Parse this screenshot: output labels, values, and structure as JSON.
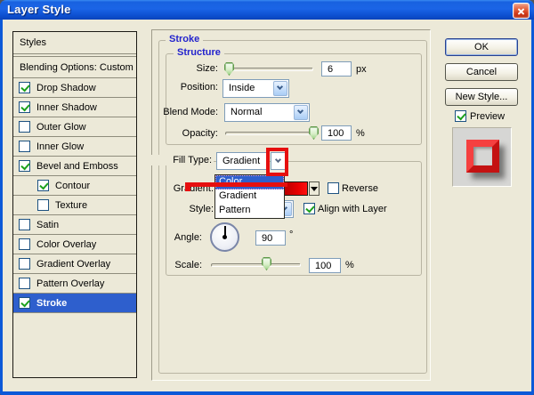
{
  "window": {
    "title": "Layer Style"
  },
  "styles_panel": {
    "header": "Styles",
    "blending": "Blending Options: Custom",
    "items": [
      {
        "label": "Drop Shadow",
        "checked": true
      },
      {
        "label": "Inner Shadow",
        "checked": true
      },
      {
        "label": "Outer Glow",
        "checked": false
      },
      {
        "label": "Inner Glow",
        "checked": false
      },
      {
        "label": "Bevel and Emboss",
        "checked": true
      },
      {
        "label": "Contour",
        "checked": true,
        "indent": true
      },
      {
        "label": "Texture",
        "checked": false,
        "indent": true
      },
      {
        "label": "Satin",
        "checked": false
      },
      {
        "label": "Color Overlay",
        "checked": false
      },
      {
        "label": "Gradient Overlay",
        "checked": false
      },
      {
        "label": "Pattern Overlay",
        "checked": false
      },
      {
        "label": "Stroke",
        "checked": true,
        "selected": true
      }
    ]
  },
  "stroke_panel": {
    "group_label": "Stroke",
    "structure_label": "Structure",
    "size": {
      "label": "Size:",
      "value": "6",
      "unit": "px"
    },
    "position": {
      "label": "Position:",
      "value": "Inside"
    },
    "blend_mode": {
      "label": "Blend Mode:",
      "value": "Normal"
    },
    "opacity": {
      "label": "Opacity:",
      "value": "100",
      "unit": "%"
    },
    "fill_type": {
      "label": "Fill Type:",
      "value": "Gradient"
    },
    "fill_type_options": [
      "Color",
      "Gradient",
      "Pattern"
    ],
    "fill_type_highlighted_option": "Color",
    "gradient": {
      "label": "Gradient:",
      "reverse_label": "Reverse",
      "reverse_checked": false
    },
    "style": {
      "label": "Style:",
      "align_label": "Align with Layer",
      "align_checked": true
    },
    "angle": {
      "label": "Angle:",
      "value": "90",
      "unit": "°"
    },
    "scale": {
      "label": "Scale:",
      "value": "100",
      "unit": "%"
    }
  },
  "buttons": {
    "ok": "OK",
    "cancel": "Cancel",
    "new_style": "New Style...",
    "preview": "Preview",
    "preview_checked": true
  },
  "colors": {
    "dialog_background": "#ece9d8",
    "titlebar_blue": "#1862e0",
    "selection_blue": "#2e5fcd",
    "group_label_blue": "#2323cd",
    "check_green": "#1ca11c",
    "annotation_red": "#e60f0f",
    "preview_stroke_red": "#e32222"
  }
}
